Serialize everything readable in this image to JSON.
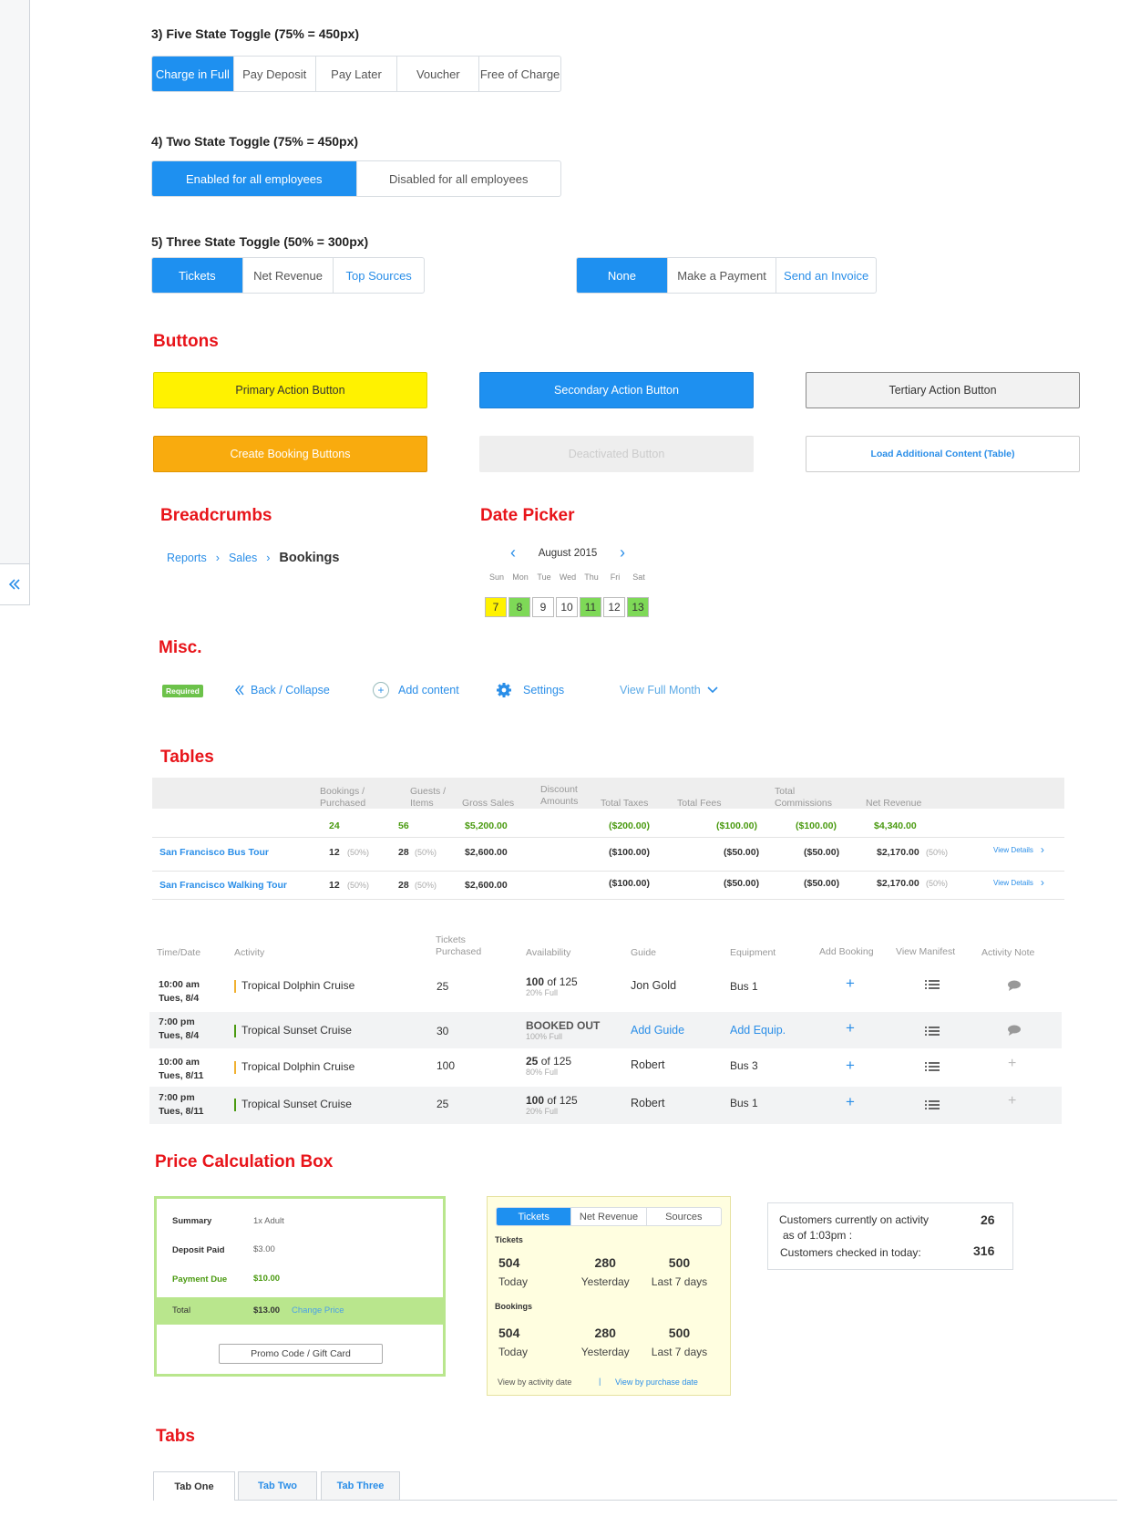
{
  "toggles": {
    "five": {
      "title": "3) Five State Toggle (75% = 450px)",
      "options": [
        "Charge in Full",
        "Pay Deposit",
        "Pay Later",
        "Voucher",
        "Free of Charge"
      ]
    },
    "two": {
      "title": "4) Two State Toggle  (75% = 450px)",
      "options": [
        "Enabled for all employees",
        "Disabled for all employees"
      ]
    },
    "three": {
      "title": "5) Three State Toggle (50% = 300px)",
      "a": [
        "Tickets",
        "Net Revenue",
        "Top Sources"
      ],
      "b": [
        "None",
        "Make a Payment",
        "Send an Invoice"
      ]
    }
  },
  "buttons": {
    "title": "Buttons",
    "primary": "Primary Action Button",
    "secondary": "Secondary Action Button",
    "tertiary": "Tertiary Action Button",
    "create": "Create Booking Buttons",
    "deactivated": "Deactivated Button",
    "load": "Load Additional Content (Table)"
  },
  "breadcrumbs": {
    "title": "Breadcrumbs",
    "items": [
      "Reports",
      "Sales",
      "Bookings"
    ]
  },
  "datepicker": {
    "title": "Date Picker",
    "month": "August 2015",
    "days": [
      "Sun",
      "Mon",
      "Tue",
      "Wed",
      "Thu",
      "Fri",
      "Sat"
    ],
    "dates": [
      "7",
      "8",
      "9",
      "10",
      "11",
      "12",
      "13"
    ]
  },
  "misc": {
    "title": "Misc.",
    "required": "Required",
    "back": "Back / Collapse",
    "add": "Add content",
    "settings": "Settings",
    "full_month": "View Full Month"
  },
  "tables": {
    "title": "Tables",
    "headers": [
      "Bookings / Purchased",
      "Guests / Items",
      "Gross Sales",
      "Discount Amounts",
      "Total Taxes",
      "Total Fees",
      "Total Commissions",
      "Net Revenue"
    ],
    "totals": [
      "24",
      "56",
      "$5,200.00",
      "($200.00)",
      "($100.00)",
      "($100.00)",
      "$4,340.00"
    ],
    "rows": [
      {
        "name": "San Francisco Bus Tour",
        "bookings": "12",
        "bpct": "(50%)",
        "guests": "28",
        "gpct": "(50%)",
        "gross": "$2,600.00",
        "taxes": "($100.00)",
        "fees": "($50.00)",
        "comm": "($50.00)",
        "net": "$2,170.00",
        "npct": "(50%)",
        "link": "View Details"
      },
      {
        "name": "San Francisco Walking Tour",
        "bookings": "12",
        "bpct": "(50%)",
        "guests": "28",
        "gpct": "(50%)",
        "gross": "$2,600.00",
        "taxes": "($100.00)",
        "fees": "($50.00)",
        "comm": "($50.00)",
        "net": "$2,170.00",
        "npct": "(50%)",
        "link": "View Details"
      }
    ],
    "manifest_headers": [
      "Time/Date",
      "Activity",
      "Tickets Purchased",
      "Availability",
      "Guide",
      "Equipment",
      "Add Booking",
      "View Manifest",
      "Activity Note"
    ],
    "manifest_rows": [
      {
        "time": "10:00 am",
        "date": "Tues, 8/4",
        "activity": "Tropical Dolphin Cruise",
        "color": "#f0b030",
        "tickets": "25",
        "avail_main": "100",
        "avail_of": " of 125",
        "avail_sub": "20% Full",
        "guide": "Jon Gold",
        "guide_link": false,
        "equip": "Bus 1",
        "equip_link": false,
        "note": "bubble"
      },
      {
        "time": "7:00 pm",
        "date": "Tues, 8/4",
        "activity": "Tropical Sunset Cruise",
        "color": "#4a9a10",
        "tickets": "30",
        "avail_main": "BOOKED OUT",
        "avail_of": "",
        "avail_sub": "100% Full",
        "guide": "Add Guide",
        "guide_link": true,
        "equip": "Add Equip.",
        "equip_link": true,
        "note": "bubble"
      },
      {
        "time": "10:00 am",
        "date": "Tues, 8/11",
        "activity": "Tropical Dolphin Cruise",
        "color": "#f0b030",
        "tickets": "100",
        "avail_main": "25",
        "avail_of": " of 125",
        "avail_sub": "80% Full",
        "guide": "Robert",
        "guide_link": false,
        "equip": "Bus 3",
        "equip_link": false,
        "note": "plus"
      },
      {
        "time": "7:00 pm",
        "date": "Tues, 8/11",
        "activity": "Tropical Sunset Cruise",
        "color": "#4a9a10",
        "tickets": "25",
        "avail_main": "100",
        "avail_of": " of 125",
        "avail_sub": "20% Full",
        "guide": "Robert",
        "guide_link": false,
        "equip": "Bus 1",
        "equip_link": false,
        "note": "plus"
      }
    ]
  },
  "price_box": {
    "title": "Price Calculation Box",
    "summary_label": "Summary",
    "summary_val": "1x Adult",
    "deposit_label": "Deposit Paid",
    "deposit_val": "$3.00",
    "due_label": "Payment Due",
    "due_val": "$10.00",
    "total_label": "Total",
    "total_val": "$13.00",
    "change": "Change Price",
    "promo": "Promo Code / Gift Card"
  },
  "stats_box": {
    "tabs": [
      "Tickets",
      "Net Revenue",
      "Sources"
    ],
    "tickets_label": "Tickets",
    "bookings_label": "Bookings",
    "tickets": [
      {
        "n": "504",
        "l": "Today"
      },
      {
        "n": "280",
        "l": "Yesterday"
      },
      {
        "n": "500",
        "l": "Last 7 days"
      }
    ],
    "bookings": [
      {
        "n": "504",
        "l": "Today"
      },
      {
        "n": "280",
        "l": "Yesterday"
      },
      {
        "n": "500",
        "l": "Last 7 days"
      }
    ],
    "link1": "View by activity date",
    "sep": "|",
    "link2": "View by purchase date"
  },
  "customers_box": {
    "line1": "Customers currently on activity",
    "line2": "as of 1:03pm :",
    "line3": "Customers checked in today:",
    "val1": "26",
    "val2": "316"
  },
  "tabs": {
    "title": "Tabs",
    "items": [
      "Tab One",
      "Tab Two",
      "Tab Three"
    ]
  }
}
